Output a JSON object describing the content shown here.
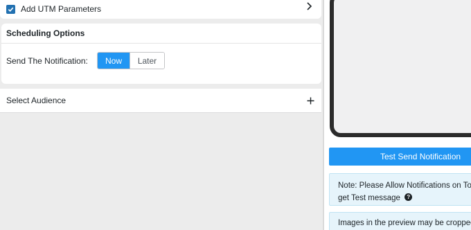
{
  "utm": {
    "label": "Add UTM Parameters",
    "checked": true
  },
  "scheduling": {
    "title": "Scheduling Options",
    "send_label": "Send The Notification:",
    "options": [
      "Now",
      "Later"
    ],
    "selected": "Now"
  },
  "audience": {
    "label": "Select Audience"
  },
  "preview": {
    "test_button": "Test Send Notification",
    "note_line1": "Note: Please Allow Notifications on Top",
    "note_line2": "get Test message",
    "crop_note": "Images in the preview may be cropped"
  },
  "colors": {
    "accent": "#2196f3",
    "checkbox": "#2271b1",
    "note_bg": "#e6f4fb"
  }
}
